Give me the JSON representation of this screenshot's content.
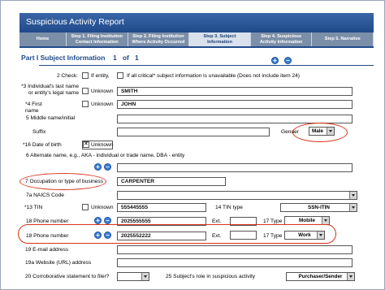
{
  "window": {
    "title": "Suspicious Activity Report"
  },
  "tabs": [
    "Home",
    "Step 1. Filing Institution Contact Information",
    "Step 2. Filing Institution Where Activity Occurred",
    "Step 3. Subject Information",
    "Step 4. Suspicious Activity Information",
    "Step 5. Narrative"
  ],
  "part": {
    "title": "Part I Subject Information",
    "index": "1",
    "of": "of",
    "total": "1"
  },
  "fields": {
    "check_label": "2 Check:",
    "if_entity": "If entity,",
    "if_all_critical": "If all critical* subject information is unavailable (Does not include item 24)",
    "legal_name_label": "*3 Individual's last name or entity's legal name",
    "unknown": "Unknown",
    "legal_name_value": "SMITH",
    "first_name_label": "*4 First name",
    "first_name_value": "JOHN",
    "middle_label": "5 Middle name/initial",
    "suffix_label": "Suffix",
    "gender_label": "Gender",
    "gender_value": "Male",
    "dob_label": "*16 Date of birth",
    "alt_name_label": "6 Alternate name, e.g., AKA - individual or trade name, DBA - entity",
    "occupation_label": "7 Occupation or type of business",
    "occupation_value": "CARPENTER",
    "naics_label": "7a NAICS Code",
    "tin_label": "*13 TIN",
    "tin_value": "555445555",
    "tin_type_label": "14 TIN type",
    "tin_type_value": "SSN-ITIN",
    "phone_label": "18 Phone number",
    "phone1_value": "2025555555",
    "ext_label": "Ext.",
    "type_label": "17 Type",
    "phone1_type": "Mobile",
    "phone2_value": "2025552222",
    "phone2_type": "Work",
    "email_label": "19 E-mail address",
    "website_label": "19a Website (URL) address",
    "corroborative_label": "20 Corroborative statement to filer?",
    "role_label": "25 Subject's role in suspicious activity",
    "role_value": "Purchaser/Sender"
  },
  "icons": {
    "plus": "+",
    "minus": "–"
  },
  "colors": {
    "title_bar": "#1f4a8a",
    "highlight_oval": "#d9331b",
    "circle_button": "#3f7fd8"
  }
}
